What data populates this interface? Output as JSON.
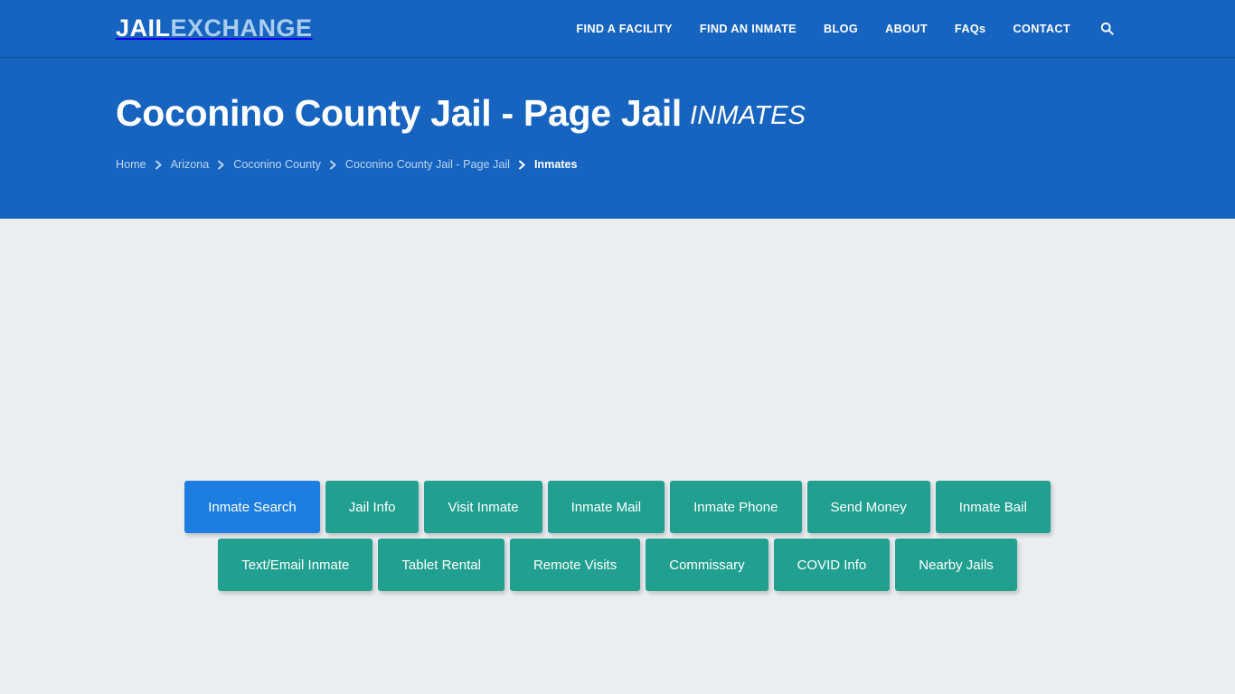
{
  "site": {
    "logo_primary": "JAIL",
    "logo_secondary": "EXCHANGE",
    "accent_blue": "#1664c0",
    "active_blue": "#1c7ee0",
    "teal": "#21a090",
    "body_bg": "#eaeef1"
  },
  "nav": {
    "items": [
      {
        "label": "FIND A FACILITY",
        "name": "nav-find-a-facility"
      },
      {
        "label": "FIND AN INMATE",
        "name": "nav-find-an-inmate"
      },
      {
        "label": "BLOG",
        "name": "nav-blog"
      },
      {
        "label": "ABOUT",
        "name": "nav-about"
      },
      {
        "label": "FAQs",
        "name": "nav-faqs"
      },
      {
        "label": "CONTACT",
        "name": "nav-contact"
      }
    ],
    "search_icon": "search-icon"
  },
  "hero": {
    "title": "Coconino County Jail - Page Jail",
    "title_suffix": "INMATES",
    "breadcrumb": [
      {
        "label": "Home",
        "current": false
      },
      {
        "label": "Arizona",
        "current": false
      },
      {
        "label": "Coconino County",
        "current": false
      },
      {
        "label": "Coconino County Jail - Page Jail",
        "current": false
      },
      {
        "label": "Inmates",
        "current": true
      }
    ],
    "breadcrumb_separator_icon": "chevron-right-icon"
  },
  "tabs": {
    "row1": [
      {
        "label": "Inmate Search",
        "active": true
      },
      {
        "label": "Jail Info",
        "active": false
      },
      {
        "label": "Visit Inmate",
        "active": false
      },
      {
        "label": "Inmate Mail",
        "active": false
      },
      {
        "label": "Inmate Phone",
        "active": false
      },
      {
        "label": "Send Money",
        "active": false
      },
      {
        "label": "Inmate Bail",
        "active": false
      }
    ],
    "row2": [
      {
        "label": "Text/Email Inmate",
        "active": false
      },
      {
        "label": "Tablet Rental",
        "active": false
      },
      {
        "label": "Remote Visits",
        "active": false
      },
      {
        "label": "Commissary",
        "active": false
      },
      {
        "label": "COVID Info",
        "active": false
      },
      {
        "label": "Nearby Jails",
        "active": false
      }
    ]
  }
}
